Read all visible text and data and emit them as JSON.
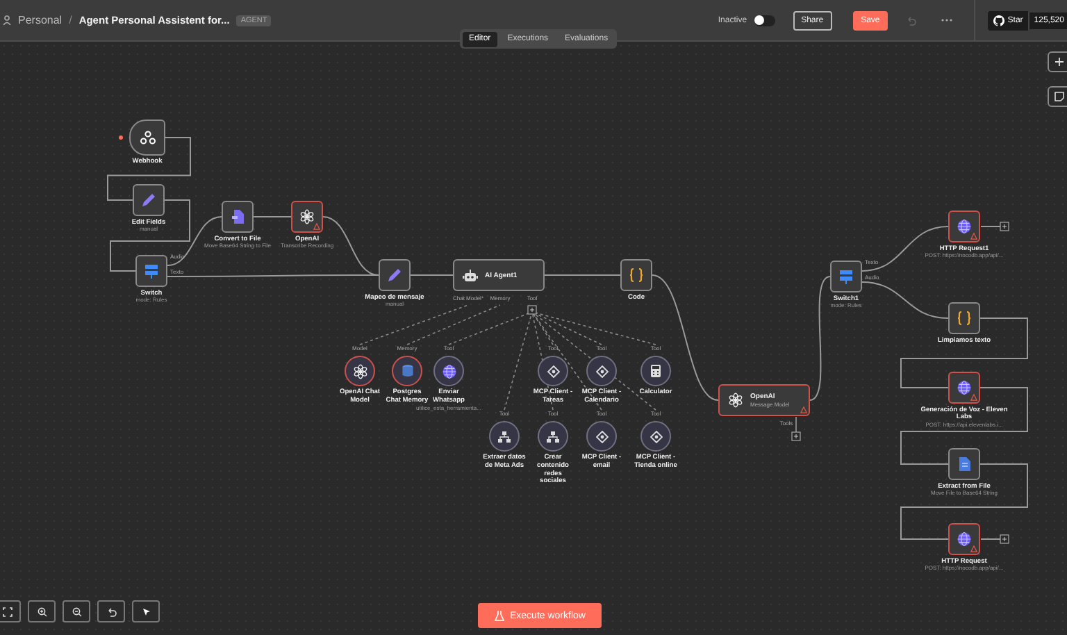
{
  "header": {
    "breadcrumb": "Personal",
    "separator": "/",
    "title": "Agent Personal Assistent for...",
    "badge": "AGENT",
    "status": {
      "label": "Inactive",
      "on": false
    },
    "share": "Share",
    "save": "Save",
    "star": "Star",
    "star_count": "125,520"
  },
  "tabs": [
    {
      "label": "Editor",
      "selected": true
    },
    {
      "label": "Executions",
      "selected": false
    },
    {
      "label": "Evaluations",
      "selected": false
    }
  ],
  "nodes": [
    {
      "kind": "webhook",
      "title": "Webhook",
      "error": false
    },
    {
      "kind": "set",
      "title": "Edit Fields",
      "subtitle": "manual",
      "error": false
    },
    {
      "kind": "switch",
      "title": "Switch",
      "subtitle": "mode: Rules",
      "outputs": [
        "Audio",
        "Texto"
      ],
      "error": false
    },
    {
      "kind": "file",
      "title": "Convert to File",
      "subtitle": "Move Base64 String to File",
      "error": false
    },
    {
      "kind": "openai",
      "title": "OpenAI",
      "subtitle": "Transcribe Recording",
      "error": true
    },
    {
      "kind": "set",
      "title": "Mapeo de mensaje",
      "subtitle": "manual",
      "error": false
    },
    {
      "kind": "agent",
      "title": "AI Agent1",
      "ports": [
        "Chat Model*",
        "Memory",
        "Tool"
      ],
      "error": false
    },
    {
      "kind": "code",
      "title": "Code",
      "error": false
    },
    {
      "kind": "openai",
      "title": "OpenAI",
      "subtitle": "Message Model",
      "ports": [
        "Tools"
      ],
      "error": true
    },
    {
      "kind": "switch",
      "title": "Switch1",
      "subtitle": "mode: Rules",
      "outputs": [
        "Texto",
        "Audio"
      ],
      "error": false
    },
    {
      "kind": "http",
      "title": "HTTP Request1",
      "subtitle": "POST: https://nocodb.app/api/...",
      "error": true
    },
    {
      "kind": "code",
      "title": "Limpiamos texto",
      "error": false
    },
    {
      "kind": "http",
      "title": "Generación de Voz - Eleven Labs",
      "subtitle": "POST: https://api.elevenlabs.i...",
      "error": true
    },
    {
      "kind": "extract",
      "title": "Extract from File",
      "subtitle": "Move File to Base64 String",
      "error": false
    },
    {
      "kind": "http",
      "title": "HTTP Request",
      "subtitle": "POST: https://nocodb.app/api/...",
      "error": true
    },
    {
      "kind": "openai",
      "title": "OpenAI Chat Model",
      "port": "Model",
      "error": true
    },
    {
      "kind": "database",
      "title": "Postgres Chat Memory",
      "port": "Memory",
      "error": true
    },
    {
      "kind": "http",
      "title": "Enviar Whatsapp",
      "subtitle": "utilice_esta_herramienta...",
      "port": "Tool",
      "error": false
    },
    {
      "kind": "mcp",
      "title": "MCP Client - Tareas",
      "port": "Tool",
      "error": false
    },
    {
      "kind": "mcp",
      "title": "MCP Client - Calendario",
      "port": "Tool",
      "error": false
    },
    {
      "kind": "calculator",
      "title": "Calculator",
      "port": "Tool",
      "error": false
    },
    {
      "kind": "workflow",
      "title": "Extraer datos de Meta Ads",
      "port": "Tool",
      "error": false
    },
    {
      "kind": "workflow",
      "title": "Crear contenido redes sociales",
      "port": "Tool",
      "error": false
    },
    {
      "kind": "mcp",
      "title": "MCP Client - email",
      "port": "Tool",
      "error": false
    },
    {
      "kind": "mcp",
      "title": "MCP Client - Tienda online",
      "port": "Tool",
      "error": false
    }
  ],
  "execute_button": "Execute workflow"
}
